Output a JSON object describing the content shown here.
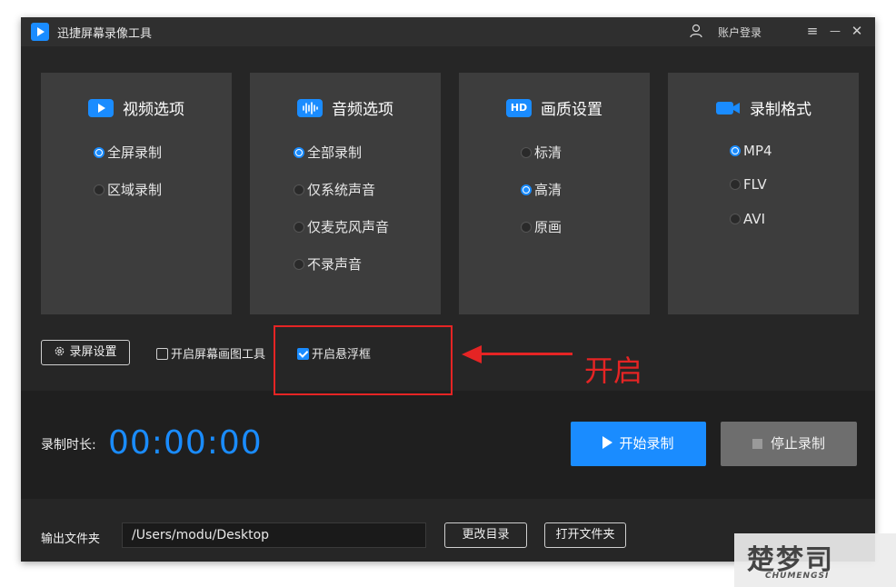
{
  "titlebar": {
    "app_title": "迅捷屏幕录像工具",
    "login_label": "账户登录",
    "menu_icon": "≡",
    "minimize_icon": "—",
    "close_icon": "✕"
  },
  "cards": [
    {
      "title": "视频选项",
      "icon": "video-play-icon",
      "options": [
        {
          "label": "全屏录制",
          "selected": true
        },
        {
          "label": "区域录制",
          "selected": false
        }
      ]
    },
    {
      "title": "音频选项",
      "icon": "sound-wave-icon",
      "options": [
        {
          "label": "全部录制",
          "selected": true
        },
        {
          "label": "仅系统声音",
          "selected": false
        },
        {
          "label": "仅麦克风声音",
          "selected": false
        },
        {
          "label": "不录声音",
          "selected": false
        }
      ]
    },
    {
      "title": "画质设置",
      "icon": "hd-icon",
      "icon_text": "HD",
      "options": [
        {
          "label": "标清",
          "selected": false
        },
        {
          "label": "高清",
          "selected": true
        },
        {
          "label": "原画",
          "selected": false
        }
      ]
    },
    {
      "title": "录制格式",
      "icon": "camera-icon",
      "options": [
        {
          "label": "MP4",
          "selected": true
        },
        {
          "label": "FLV",
          "selected": false
        },
        {
          "label": "AVI",
          "selected": false
        }
      ]
    }
  ],
  "options_row": {
    "settings_button": "录屏设置",
    "draw_tool": {
      "label": "开启屏幕画图工具",
      "checked": false
    },
    "float_window": {
      "label": "开启悬浮框",
      "checked": true
    }
  },
  "annotation": {
    "text": "开启"
  },
  "record": {
    "duration_label": "录制时长:",
    "timer": "00:00:00",
    "start_button": "开始录制",
    "stop_button": "停止录制"
  },
  "output": {
    "label": "输出文件夹",
    "path": "/Users/modu/Desktop",
    "change_dir_button": "更改目录",
    "open_folder_button": "打开文件夹"
  },
  "watermark": {
    "main": "楚梦司",
    "sub": "CHUMENGSI"
  },
  "colors": {
    "accent": "#1a8cff",
    "annotation_red": "#e52424",
    "panel": "#3d3d3d",
    "background": "#262626"
  }
}
